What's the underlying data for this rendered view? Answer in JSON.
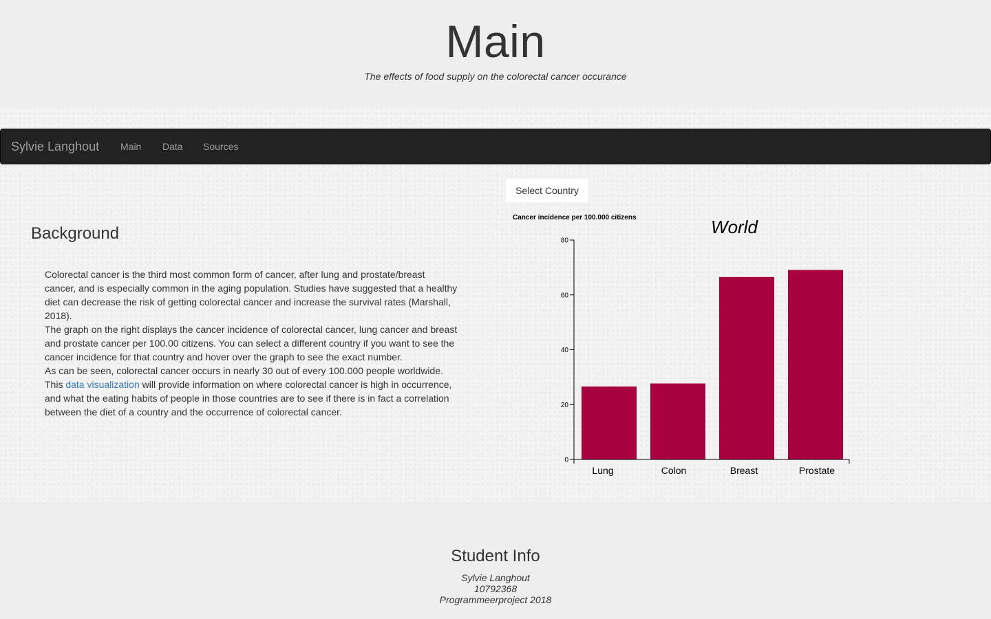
{
  "header": {
    "title": "Main",
    "subtitle": "The effects of food supply on the colorectal cancer occurance"
  },
  "navbar": {
    "brand": "Sylvie Langhout",
    "items": [
      {
        "label": "Main"
      },
      {
        "label": "Data"
      },
      {
        "label": "Sources"
      }
    ]
  },
  "select_country": {
    "label": "Select Country"
  },
  "background": {
    "heading": "Background",
    "paragraph_1": "Colorectal cancer is the third most common form of cancer, after lung and prostate/breast cancer, and is especially common in the aging population. Studies have suggested that a healthy diet can decrease the risk of getting colorectal cancer and increase the survival rates (Marshall, 2018).",
    "paragraph_2": "The graph on the right displays the cancer incidence of colorectal cancer, lung cancer and breast and prostate cancer per 100.00 citizens. You can select a different country if you want to see the cancer incidence for that country and hover over the graph to see the exact number.",
    "paragraph_3": "As can be seen, colorectal cancer occurs in nearly 30 out of every 100.000 people worldwide.",
    "paragraph_4_before": "This ",
    "paragraph_4_link": "data visualization",
    "paragraph_4_after": " will provide information on where colorectal cancer is high in occurrence, and what the eating habits of people in those countries are to see if there is in fact a correlation between the diet of a country and the occurrence of colorectal cancer."
  },
  "chart_data": {
    "type": "bar",
    "title": "World",
    "ylabel": "Cancer incidence per 100.000 citizens",
    "xlabel": "",
    "categories": [
      "Lung",
      "Colon",
      "Breast",
      "Prostate"
    ],
    "values": [
      26.6,
      27.7,
      66.5,
      69.1
    ],
    "ylim": [
      0,
      80
    ],
    "yticks": [
      0,
      20,
      40,
      60,
      80
    ],
    "bar_color": "#a9003f",
    "grid": false
  },
  "footer": {
    "heading": "Student Info",
    "name": "Sylvie Langhout",
    "student_number": "10792368",
    "project": "Programmeerproject 2018"
  }
}
